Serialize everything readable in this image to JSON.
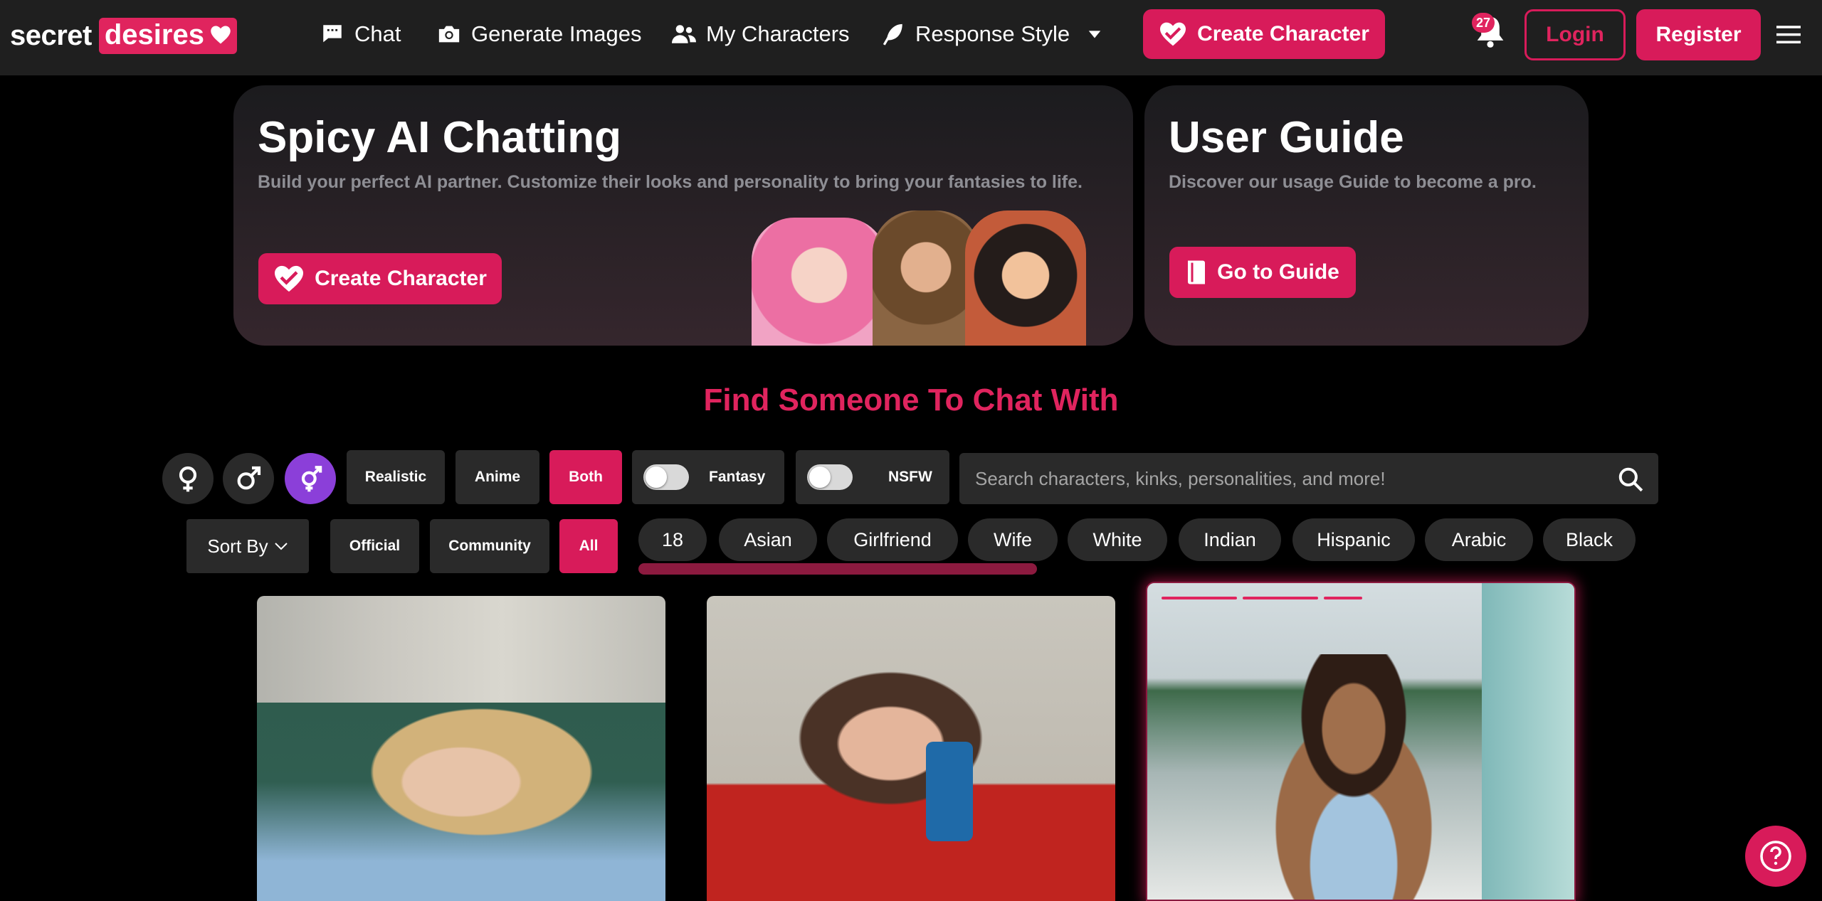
{
  "brand": {
    "word1": "secret",
    "word2": "desires"
  },
  "nav": {
    "items": [
      {
        "label": "Chat",
        "icon": "chat-icon"
      },
      {
        "label": "Generate Images",
        "icon": "camera-icon"
      },
      {
        "label": "My Characters",
        "icon": "users-icon"
      },
      {
        "label": "Response Style",
        "icon": "feather-icon"
      }
    ],
    "create_label": "Create Character",
    "notification_count": "27",
    "login_label": "Login",
    "register_label": "Register"
  },
  "hero": {
    "title": "Spicy AI Chatting",
    "subtitle": "Build your perfect AI partner. Customize their looks and personality to bring your fantasies to life.",
    "button_label": "Create Character"
  },
  "guide": {
    "title": "User Guide",
    "subtitle": "Discover our usage Guide to become a pro.",
    "button_label": "Go to Guide"
  },
  "section_title": "Find Someone To Chat With",
  "filters": {
    "gender_options": [
      "female",
      "male",
      "both"
    ],
    "gender_selected": "both",
    "style_options": [
      "Realistic",
      "Anime",
      "Both"
    ],
    "style_selected": "Both",
    "fantasy_label": "Fantasy",
    "nsfw_label": "NSFW",
    "search_placeholder": "Search characters, kinks, personalities, and more!",
    "sort_label": "Sort By",
    "source_options": [
      "Official",
      "Community",
      "All"
    ],
    "source_selected": "All",
    "tags": [
      "18",
      "Asian",
      "Girlfriend",
      "Wife",
      "White",
      "Indian",
      "Hispanic",
      "Arabic",
      "Black"
    ]
  },
  "colors": {
    "accent": "#d81b5a",
    "accent_text": "#e0245e",
    "nav_bg": "#1f1f1f",
    "panel_bg": "#2a2a2a",
    "selected_gender": "#8b3fd9"
  }
}
